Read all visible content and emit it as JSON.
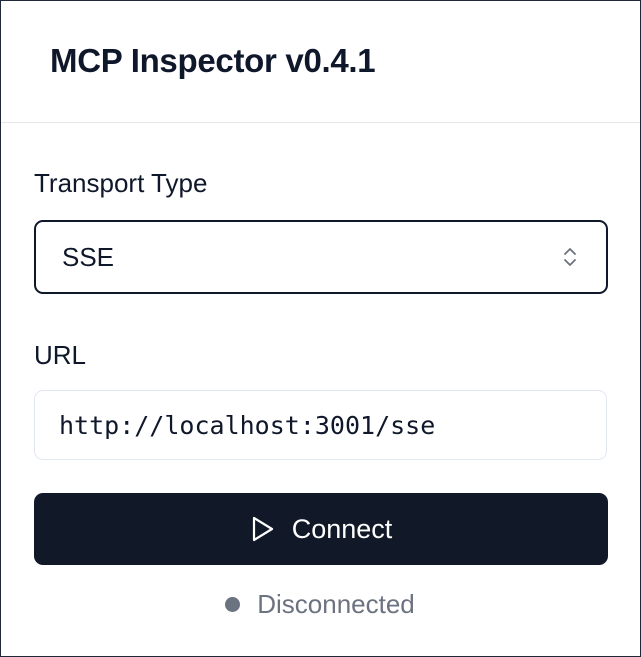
{
  "app": {
    "title": "MCP Inspector v0.4.1"
  },
  "transport": {
    "label": "Transport Type",
    "selected_value": "SSE",
    "icon": "chevrons-up-down-icon"
  },
  "url": {
    "label": "URL",
    "value": "http://localhost:3001/sse"
  },
  "connect": {
    "label": "Connect",
    "icon": "play-icon"
  },
  "status": {
    "text": "Disconnected",
    "dot_color": "#6b7280"
  },
  "colors": {
    "button_bg": "#111827",
    "border_dark": "#0f172a",
    "input_border": "#e2e8f0",
    "muted_text": "#6b7280"
  }
}
